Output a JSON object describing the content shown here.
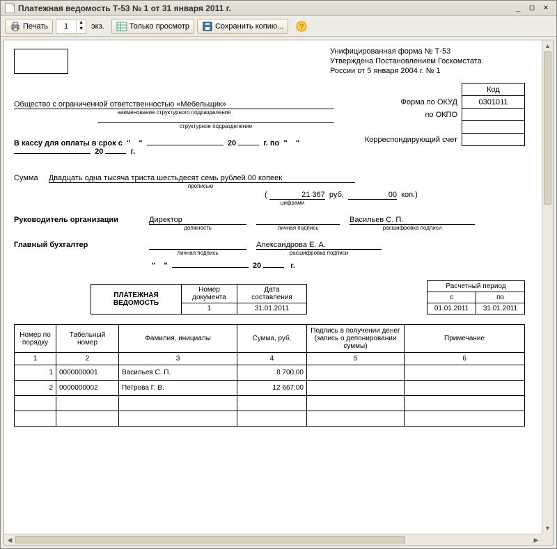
{
  "window": {
    "title": "Платежная ведомость Т-53  № 1 от 31 января 2011 г."
  },
  "toolbar": {
    "print_label": "Печать",
    "copies_value": "1",
    "copies_suffix": "экз.",
    "view_only_label": "Только просмотр",
    "save_copy_label": "Сохранить копию..."
  },
  "form_info": {
    "line1": "Унифицированная форма № Т-53",
    "line2": "Утверждена Постановлением Госкомстата",
    "line3": "России от 5 января 2004 г. № 1"
  },
  "codes": {
    "kod_label": "Код",
    "okud_label": "Форма по ОКУД",
    "okud_value": "0301011",
    "okpo_label": "по ОКПО",
    "okpo_value": "",
    "corr_label": "Корреспондирующий счет",
    "corr_value": ""
  },
  "org": {
    "name": "Общество с ограниченной ответственностью «Мебельщик»",
    "subunit_caption": "наименование структурного подразделения",
    "subunit2_caption": "структурное подразделение"
  },
  "cash": {
    "prefix": "В кассу для оплаты в срок с",
    "mid": "г. по",
    "year_suffix": "г.",
    "twenty": "20"
  },
  "sum": {
    "label": "Сумма",
    "words": "Двадцать одна тысяча триста шестьдесят семь рублей 00 копеек",
    "words_caption": "прописью",
    "digits_value": "21 367",
    "digits_rub": "руб.",
    "digits_kop_value": "00",
    "digits_kop": "коп.)",
    "digits_caption": "цифрами",
    "open_paren": "("
  },
  "manager": {
    "label": "Руководитель организации",
    "position": "Директор",
    "position_caption": "должность",
    "sign_caption": "личная подпись",
    "name": "Васильев С. П.",
    "name_caption": "расшифровка подписи"
  },
  "accountant": {
    "label": "Главный бухгалтер",
    "sign_caption": "личная подпись",
    "name": "Александрова Е. А.",
    "name_caption": "расшифровка подписи",
    "twenty": "20",
    "year_suffix": "г."
  },
  "doc_block": {
    "title_line1": "ПЛАТЕЖНАЯ",
    "title_line2": "ВЕДОМОСТЬ",
    "num_label": "Номер\nдокумента",
    "num_value": "1",
    "date_label": "Дата\nсоставления",
    "date_value": "31.01.2011"
  },
  "period": {
    "header": "Расчетный период",
    "from_label": "с",
    "to_label": "по",
    "from": "01.01.2011",
    "to": "31.01.2011"
  },
  "table": {
    "headers": {
      "n": "Номер по порядку",
      "tab": "Табельный номер",
      "fio": "Фамилия, инициалы",
      "sum": "Сумма, руб.",
      "sign": "Подпись в получении денег (запись о депонировании суммы)",
      "note": "Примечание"
    },
    "colnums": {
      "c1": "1",
      "c2": "2",
      "c3": "3",
      "c4": "4",
      "c5": "5",
      "c6": "6"
    },
    "rows": [
      {
        "n": "1",
        "tab": "0000000001",
        "fio": "Васильев С. П.",
        "sum": "8 700,00",
        "sign": "",
        "note": ""
      },
      {
        "n": "2",
        "tab": "0000000002",
        "fio": "Петрова Г. В.",
        "sum": "12 667,00",
        "sign": "",
        "note": ""
      },
      {
        "n": "",
        "tab": "",
        "fio": "",
        "sum": "",
        "sign": "",
        "note": ""
      },
      {
        "n": "",
        "tab": "",
        "fio": "",
        "sum": "",
        "sign": "",
        "note": ""
      }
    ]
  }
}
